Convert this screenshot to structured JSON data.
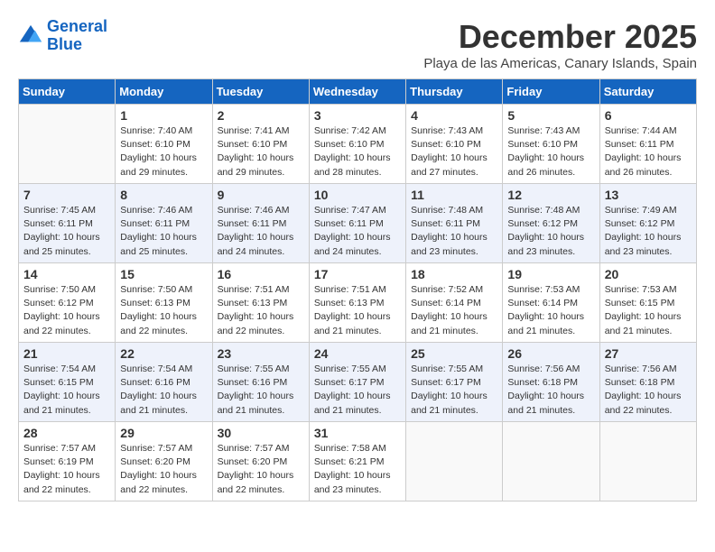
{
  "logo": {
    "line1": "General",
    "line2": "Blue"
  },
  "title": "December 2025",
  "location": "Playa de las Americas, Canary Islands, Spain",
  "weekdays": [
    "Sunday",
    "Monday",
    "Tuesday",
    "Wednesday",
    "Thursday",
    "Friday",
    "Saturday"
  ],
  "weeks": [
    [
      {
        "day": null
      },
      {
        "day": "1",
        "sunrise": "Sunrise: 7:40 AM",
        "sunset": "Sunset: 6:10 PM",
        "daylight": "Daylight: 10 hours and 29 minutes."
      },
      {
        "day": "2",
        "sunrise": "Sunrise: 7:41 AM",
        "sunset": "Sunset: 6:10 PM",
        "daylight": "Daylight: 10 hours and 29 minutes."
      },
      {
        "day": "3",
        "sunrise": "Sunrise: 7:42 AM",
        "sunset": "Sunset: 6:10 PM",
        "daylight": "Daylight: 10 hours and 28 minutes."
      },
      {
        "day": "4",
        "sunrise": "Sunrise: 7:43 AM",
        "sunset": "Sunset: 6:10 PM",
        "daylight": "Daylight: 10 hours and 27 minutes."
      },
      {
        "day": "5",
        "sunrise": "Sunrise: 7:43 AM",
        "sunset": "Sunset: 6:10 PM",
        "daylight": "Daylight: 10 hours and 26 minutes."
      },
      {
        "day": "6",
        "sunrise": "Sunrise: 7:44 AM",
        "sunset": "Sunset: 6:11 PM",
        "daylight": "Daylight: 10 hours and 26 minutes."
      }
    ],
    [
      {
        "day": "7",
        "sunrise": "Sunrise: 7:45 AM",
        "sunset": "Sunset: 6:11 PM",
        "daylight": "Daylight: 10 hours and 25 minutes."
      },
      {
        "day": "8",
        "sunrise": "Sunrise: 7:46 AM",
        "sunset": "Sunset: 6:11 PM",
        "daylight": "Daylight: 10 hours and 25 minutes."
      },
      {
        "day": "9",
        "sunrise": "Sunrise: 7:46 AM",
        "sunset": "Sunset: 6:11 PM",
        "daylight": "Daylight: 10 hours and 24 minutes."
      },
      {
        "day": "10",
        "sunrise": "Sunrise: 7:47 AM",
        "sunset": "Sunset: 6:11 PM",
        "daylight": "Daylight: 10 hours and 24 minutes."
      },
      {
        "day": "11",
        "sunrise": "Sunrise: 7:48 AM",
        "sunset": "Sunset: 6:11 PM",
        "daylight": "Daylight: 10 hours and 23 minutes."
      },
      {
        "day": "12",
        "sunrise": "Sunrise: 7:48 AM",
        "sunset": "Sunset: 6:12 PM",
        "daylight": "Daylight: 10 hours and 23 minutes."
      },
      {
        "day": "13",
        "sunrise": "Sunrise: 7:49 AM",
        "sunset": "Sunset: 6:12 PM",
        "daylight": "Daylight: 10 hours and 23 minutes."
      }
    ],
    [
      {
        "day": "14",
        "sunrise": "Sunrise: 7:50 AM",
        "sunset": "Sunset: 6:12 PM",
        "daylight": "Daylight: 10 hours and 22 minutes."
      },
      {
        "day": "15",
        "sunrise": "Sunrise: 7:50 AM",
        "sunset": "Sunset: 6:13 PM",
        "daylight": "Daylight: 10 hours and 22 minutes."
      },
      {
        "day": "16",
        "sunrise": "Sunrise: 7:51 AM",
        "sunset": "Sunset: 6:13 PM",
        "daylight": "Daylight: 10 hours and 22 minutes."
      },
      {
        "day": "17",
        "sunrise": "Sunrise: 7:51 AM",
        "sunset": "Sunset: 6:13 PM",
        "daylight": "Daylight: 10 hours and 21 minutes."
      },
      {
        "day": "18",
        "sunrise": "Sunrise: 7:52 AM",
        "sunset": "Sunset: 6:14 PM",
        "daylight": "Daylight: 10 hours and 21 minutes."
      },
      {
        "day": "19",
        "sunrise": "Sunrise: 7:53 AM",
        "sunset": "Sunset: 6:14 PM",
        "daylight": "Daylight: 10 hours and 21 minutes."
      },
      {
        "day": "20",
        "sunrise": "Sunrise: 7:53 AM",
        "sunset": "Sunset: 6:15 PM",
        "daylight": "Daylight: 10 hours and 21 minutes."
      }
    ],
    [
      {
        "day": "21",
        "sunrise": "Sunrise: 7:54 AM",
        "sunset": "Sunset: 6:15 PM",
        "daylight": "Daylight: 10 hours and 21 minutes."
      },
      {
        "day": "22",
        "sunrise": "Sunrise: 7:54 AM",
        "sunset": "Sunset: 6:16 PM",
        "daylight": "Daylight: 10 hours and 21 minutes."
      },
      {
        "day": "23",
        "sunrise": "Sunrise: 7:55 AM",
        "sunset": "Sunset: 6:16 PM",
        "daylight": "Daylight: 10 hours and 21 minutes."
      },
      {
        "day": "24",
        "sunrise": "Sunrise: 7:55 AM",
        "sunset": "Sunset: 6:17 PM",
        "daylight": "Daylight: 10 hours and 21 minutes."
      },
      {
        "day": "25",
        "sunrise": "Sunrise: 7:55 AM",
        "sunset": "Sunset: 6:17 PM",
        "daylight": "Daylight: 10 hours and 21 minutes."
      },
      {
        "day": "26",
        "sunrise": "Sunrise: 7:56 AM",
        "sunset": "Sunset: 6:18 PM",
        "daylight": "Daylight: 10 hours and 21 minutes."
      },
      {
        "day": "27",
        "sunrise": "Sunrise: 7:56 AM",
        "sunset": "Sunset: 6:18 PM",
        "daylight": "Daylight: 10 hours and 22 minutes."
      }
    ],
    [
      {
        "day": "28",
        "sunrise": "Sunrise: 7:57 AM",
        "sunset": "Sunset: 6:19 PM",
        "daylight": "Daylight: 10 hours and 22 minutes."
      },
      {
        "day": "29",
        "sunrise": "Sunrise: 7:57 AM",
        "sunset": "Sunset: 6:20 PM",
        "daylight": "Daylight: 10 hours and 22 minutes."
      },
      {
        "day": "30",
        "sunrise": "Sunrise: 7:57 AM",
        "sunset": "Sunset: 6:20 PM",
        "daylight": "Daylight: 10 hours and 22 minutes."
      },
      {
        "day": "31",
        "sunrise": "Sunrise: 7:58 AM",
        "sunset": "Sunset: 6:21 PM",
        "daylight": "Daylight: 10 hours and 23 minutes."
      },
      {
        "day": null
      },
      {
        "day": null
      },
      {
        "day": null
      }
    ]
  ]
}
